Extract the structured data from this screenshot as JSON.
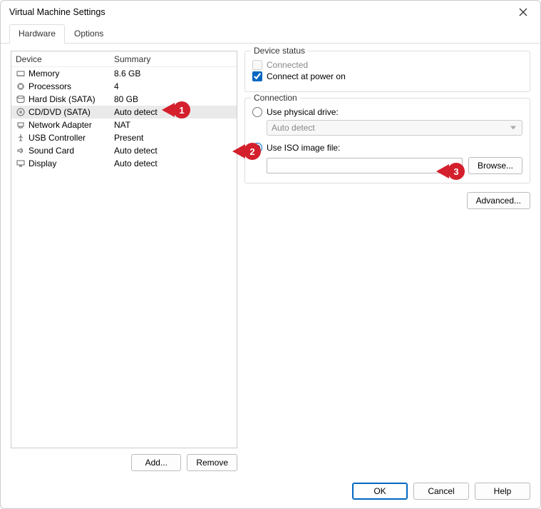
{
  "window": {
    "title": "Virtual Machine Settings"
  },
  "tabs": {
    "hardware": "Hardware",
    "options": "Options"
  },
  "list": {
    "header_device": "Device",
    "header_summary": "Summary",
    "rows": [
      {
        "icon": "memory-icon",
        "name": "Memory",
        "summary": "8.6 GB"
      },
      {
        "icon": "cpu-icon",
        "name": "Processors",
        "summary": "4"
      },
      {
        "icon": "disk-icon",
        "name": "Hard Disk (SATA)",
        "summary": "80 GB"
      },
      {
        "icon": "cddvd-icon",
        "name": "CD/DVD (SATA)",
        "summary": "Auto detect"
      },
      {
        "icon": "network-icon",
        "name": "Network Adapter",
        "summary": "NAT"
      },
      {
        "icon": "usb-icon",
        "name": "USB Controller",
        "summary": "Present"
      },
      {
        "icon": "sound-icon",
        "name": "Sound Card",
        "summary": "Auto detect"
      },
      {
        "icon": "display-icon",
        "name": "Display",
        "summary": "Auto detect"
      }
    ],
    "selected_index": 3
  },
  "left_buttons": {
    "add": "Add...",
    "remove": "Remove"
  },
  "device_status": {
    "legend": "Device status",
    "connected": {
      "label": "Connected",
      "checked": false,
      "enabled": false
    },
    "connect_power_on": {
      "label": "Connect at power on",
      "checked": true
    }
  },
  "connection": {
    "legend": "Connection",
    "use_physical": {
      "label": "Use physical drive:",
      "selected": false
    },
    "physical_combo": {
      "value": "Auto detect",
      "enabled": false
    },
    "use_iso": {
      "label": "Use ISO image file:",
      "selected": true
    },
    "iso_path": "",
    "browse": "Browse..."
  },
  "advanced": "Advanced...",
  "footer": {
    "ok": "OK",
    "cancel": "Cancel",
    "help": "Help"
  },
  "callouts": {
    "c1": "1",
    "c2": "2",
    "c3": "3"
  }
}
